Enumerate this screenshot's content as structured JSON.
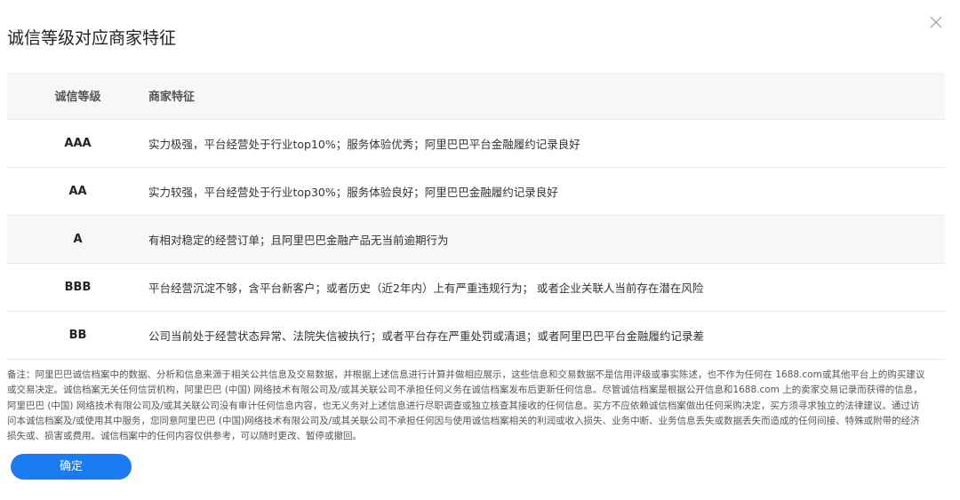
{
  "dialog": {
    "title": "诚信等级对应商家特征",
    "close_icon": "close-icon"
  },
  "table": {
    "headers": {
      "level": "诚信等级",
      "feature": "商家特征"
    },
    "rows": [
      {
        "level": "AAA",
        "feature": "实力极强，平台经营处于行业top10%；服务体验优秀；阿里巴巴平台金融履约记录良好"
      },
      {
        "level": "AA",
        "feature": "实力较强，平台经营处于行业top30%；服务体验良好；阿里巴巴金融履约记录良好"
      },
      {
        "level": "A",
        "feature": "有相对稳定的经营订单；且阿里巴巴金融产品无当前逾期行为"
      },
      {
        "level": "BBB",
        "feature": "平台经营沉淀不够，含平台新客户；或者历史（近2年内）上有严重违规行为；  或者企业关联人当前存在潜在风险"
      },
      {
        "level": "BB",
        "feature": "公司当前处于经营状态异常、法院失信被执行；或者平台存在严重处罚或清退；或者阿里巴巴平台金融履约记录差"
      }
    ]
  },
  "note": "备注：阿里巴巴诚信档案中的数据、分析和信息来源于相关公共信息及交易数据，并根据上述信息进行计算并做相应展示，这些信息和交易数据不是信用评级或事实陈述，也不作为任何在 1688.com或其他平台上的购买建议或交易决定。诚信档案无关任何信贷机构，阿里巴巴 (中国) 网络技术有限公司及/或其关联公司不承担任何义务在诚信档案发布后更新任何信息。尽管诚信档案是根据公开信息和1688.com 上的卖家交易记录而获得的信息，阿里巴巴 (中国) 网络技术有限公司及/或其关联公司没有审计任何信息内容，也无义务对上述信息进行尽职调查或独立核查其接收的任何信息。买方不应依赖诚信档案做出任何采购决定，买方须寻求独立的法律建议。通过访问本诚信档案及/或使用其中服务，您同意阿里巴巴 (中国)网络技术有限公司及/或其关联公司不承担任何因与使用诚信档案相关的利润或收入损失、业务中断、业务信息丢失或数据丢失而造成的任何间接、特殊或附带的经济损失或、损害或费用。诚信档案中的任何内容仅供参考，可以随时更改、暂停或撤回。",
  "actions": {
    "confirm_label": "确定"
  },
  "colors": {
    "accent": "#1a7cf0",
    "header_bg": "#f7f7f7",
    "border": "#e8e8e8"
  }
}
